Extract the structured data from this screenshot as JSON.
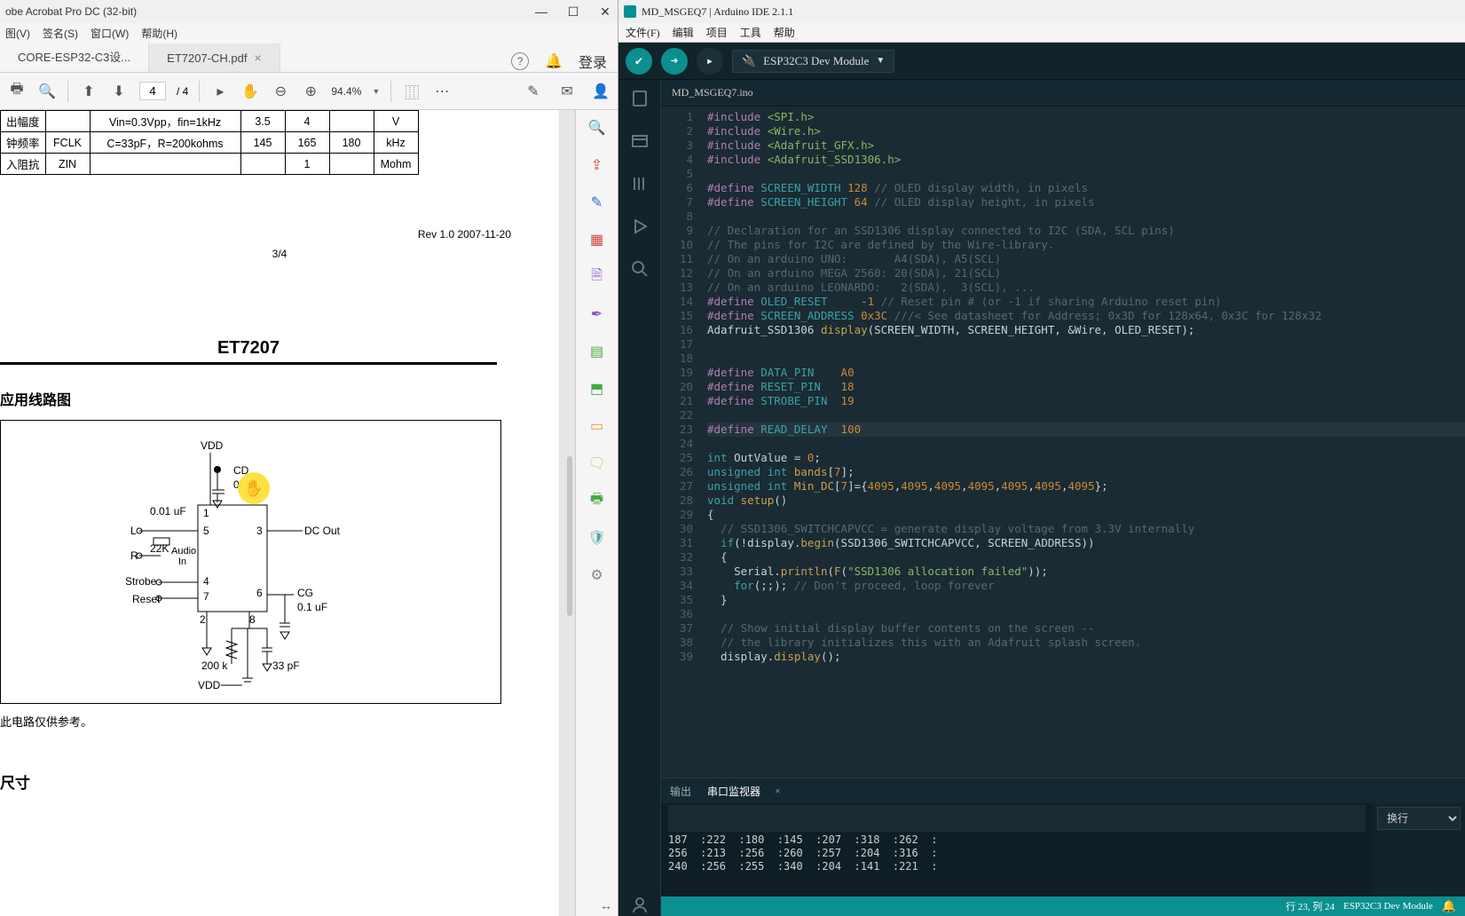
{
  "acrobat": {
    "title": "obe Acrobat Pro DC (32-bit)",
    "menu": [
      "图(V)",
      "签名(S)",
      "窗口(W)",
      "帮助(H)"
    ],
    "tabs": [
      {
        "label": "CORE-ESP32-C3设...",
        "active": false
      },
      {
        "label": "ET7207-CH.pdf",
        "active": true
      }
    ],
    "login": "登录",
    "page_in": "4",
    "page_total": "/ 4",
    "zoom": "94.4%",
    "pdf": {
      "table": {
        "rows": [
          [
            "出幅度",
            "",
            "Vin=0.3Vpp，fin=1kHz",
            "3.5",
            "4",
            "",
            "V"
          ],
          [
            "钟频率",
            "FCLK",
            "C=33pF，R=200kohms",
            "145",
            "165",
            "180",
            "kHz"
          ],
          [
            "入阻抗",
            "ZIN",
            "",
            "",
            "1",
            "",
            "Mohm"
          ]
        ]
      },
      "rev": "Rev  1.0    2007-11-20",
      "pagenum": "3/4",
      "h1": "ET7207",
      "section1": "应用线路图",
      "diagram": {
        "labels": {
          "vdd": "VDD",
          "cd": "CD",
          "cdval": "0.1 uF",
          "c01": "0.01 uF",
          "L": "L",
          "R": "R",
          "r22k": "22K",
          "audioin": "Audio\nIn",
          "dcout": "DC Out",
          "strobe": "Strobe",
          "reset": "Reset",
          "cg": "CG",
          "cgval": "0.1 uF",
          "p33": "33 pF",
          "r200k": "200 k",
          "vdd2": "VDD",
          "pins": {
            "1": "1",
            "2": "2",
            "3": "3",
            "4": "4",
            "5": "5",
            "6": "6",
            "7": "7",
            "8": "8"
          }
        }
      },
      "note": "此电路仅供参考。",
      "section2": "尺寸"
    },
    "cursor_glyph": "✋"
  },
  "arduino": {
    "title": "MD_MSGEQ7 | Arduino IDE 2.1.1",
    "menu": [
      "文件(F)",
      "编辑",
      "项目",
      "工具",
      "帮助"
    ],
    "board": "ESP32C3 Dev Module",
    "filetab": "MD_MSGEQ7.ino",
    "code_lines": [
      {
        "n": 1,
        "t": "include",
        "c": "<SPI.h>"
      },
      {
        "n": 2,
        "t": "include",
        "c": "<Wire.h>"
      },
      {
        "n": 3,
        "t": "include",
        "c": "<Adafruit_GFX.h>"
      },
      {
        "n": 4,
        "t": "include",
        "c": "<Adafruit_SSD1306.h>"
      },
      {
        "n": 5,
        "t": "blank"
      },
      {
        "n": 6,
        "t": "define",
        "a": "SCREEN_WIDTH",
        "b": "128",
        "cmt": "// OLED display width, in pixels"
      },
      {
        "n": 7,
        "t": "define",
        "a": "SCREEN_HEIGHT",
        "b": "64",
        "cmt": "// OLED display height, in pixels"
      },
      {
        "n": 8,
        "t": "blank"
      },
      {
        "n": 9,
        "t": "cmt",
        "c": "// Declaration for an SSD1306 display connected to I2C (SDA, SCL pins)"
      },
      {
        "n": 10,
        "t": "cmt",
        "c": "// The pins for I2C are defined by the Wire-library."
      },
      {
        "n": 11,
        "t": "cmt",
        "c": "// On an arduino UNO:       A4(SDA), A5(SCL)"
      },
      {
        "n": 12,
        "t": "cmt",
        "c": "// On an arduino MEGA 2560: 20(SDA), 21(SCL)"
      },
      {
        "n": 13,
        "t": "cmt",
        "c": "// On an arduino LEONARDO:   2(SDA),  3(SCL), ..."
      },
      {
        "n": 14,
        "t": "define",
        "a": "OLED_RESET",
        "b": "    -1",
        "cmt": "// Reset pin # (or -1 if sharing Arduino reset pin)"
      },
      {
        "n": 15,
        "t": "define",
        "a": "SCREEN_ADDRESS",
        "b": "0x3C",
        "cmt": "///< See datasheet for Address; 0x3D for 128x64, 0x3C for 128x32"
      },
      {
        "n": 16,
        "t": "raw",
        "c": "Adafruit_SSD1306 <fn>display</fn>(SCREEN_WIDTH, SCREEN_HEIGHT, &Wire, OLED_RESET);"
      },
      {
        "n": 17,
        "t": "blank"
      },
      {
        "n": 18,
        "t": "blank"
      },
      {
        "n": 19,
        "t": "define",
        "a": "DATA_PIN",
        "b": "   A0"
      },
      {
        "n": 20,
        "t": "define",
        "a": "RESET_PIN",
        "b": "  18"
      },
      {
        "n": 21,
        "t": "define",
        "a": "STROBE_PIN",
        "b": " 19"
      },
      {
        "n": 22,
        "t": "blank"
      },
      {
        "n": 23,
        "t": "define",
        "a": "READ_DELAY",
        "b": " 100",
        "active": true
      },
      {
        "n": 24,
        "t": "blank"
      },
      {
        "n": 25,
        "t": "raw",
        "c": "<type>int</type> OutValue = <num>0</num>;"
      },
      {
        "n": 26,
        "t": "raw",
        "c": "<type>unsigned int</type> <fn>bands</fn>[<num>7</num>];"
      },
      {
        "n": 27,
        "t": "raw",
        "c": "<type>unsigned int</type> <fn>Min_DC</fn>[<num>7</num>]={<num>4095</num>,<num>4095</num>,<num>4095</num>,<num>4095</num>,<num>4095</num>,<num>4095</num>,<num>4095</num>};"
      },
      {
        "n": 28,
        "t": "raw",
        "c": "<type>void</type> <fn>setup</fn>()"
      },
      {
        "n": 29,
        "t": "raw",
        "c": "{"
      },
      {
        "n": 30,
        "t": "raw",
        "c": "  <cmt>// SSD1306_SWITCHCAPVCC = generate display voltage from 3.3V internally</cmt>"
      },
      {
        "n": 31,
        "t": "raw",
        "c": "  <kw>if</kw>(!display.<fn>begin</fn>(SSD1306_SWITCHCAPVCC, SCREEN_ADDRESS))"
      },
      {
        "n": 32,
        "t": "raw",
        "c": "  {"
      },
      {
        "n": 33,
        "t": "raw",
        "c": "    Serial.<fn>println</fn>(<fn>F</fn>(<str>\"SSD1306 allocation failed\"</str>));"
      },
      {
        "n": 34,
        "t": "raw",
        "c": "    <kw>for</kw>(;;); <cmt>// Don't proceed, loop forever</cmt>"
      },
      {
        "n": 35,
        "t": "raw",
        "c": "  }"
      },
      {
        "n": 36,
        "t": "blank"
      },
      {
        "n": 37,
        "t": "raw",
        "c": "  <cmt>// Show initial display buffer contents on the screen --</cmt>"
      },
      {
        "n": 38,
        "t": "raw",
        "c": "  <cmt>// the library initializes this with an Adafruit splash screen.</cmt>"
      },
      {
        "n": 39,
        "t": "raw",
        "c": "  display.<fn>display</fn>();"
      }
    ],
    "panel": {
      "tab_output": "输出",
      "tab_serial": "串口监视器",
      "dropdown": "换行",
      "serial_lines": [
        "187  :222  :180  :145  :207  :318  :262  :",
        "256  :213  :256  :260  :257  :204  :316  :",
        "240  :256  :255  :340  :204  :141  :221  :"
      ]
    },
    "status": {
      "cursor": "行 23, 列 24",
      "board": "ESP32C3 Dev Module"
    }
  }
}
